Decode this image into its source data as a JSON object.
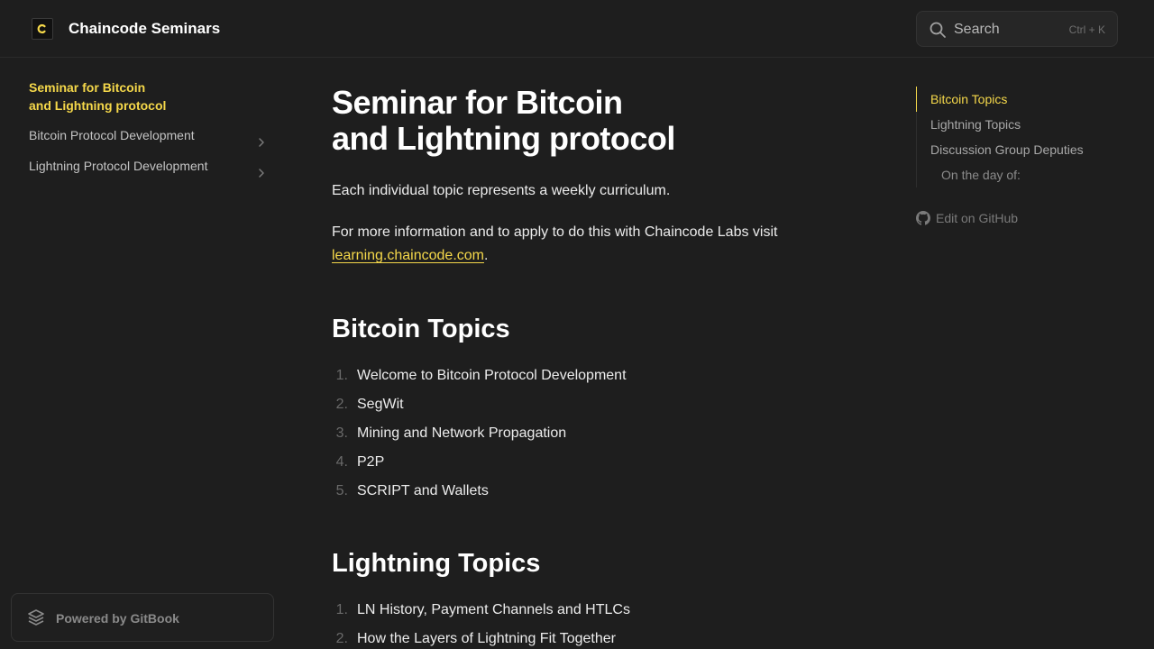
{
  "header": {
    "site_title": "Chaincode Seminars",
    "search": {
      "label": "Search",
      "shortcut": "Ctrl + K"
    }
  },
  "sidebar": {
    "active_page_line1": "Seminar for Bitcoin",
    "active_page_line2": "and Lightning protocol",
    "items": [
      {
        "label": "Bitcoin Protocol Development"
      },
      {
        "label": "Lightning Protocol Development"
      }
    ],
    "powered_by": "Powered by GitBook"
  },
  "main": {
    "title_line1": "Seminar for Bitcoin",
    "title_line2": "and Lightning protocol",
    "intro": "Each individual topic represents a weekly curriculum.",
    "info_prefix": "For more information and to apply to do this with Chaincode Labs visit",
    "info_link": "learning.chaincode.com",
    "info_suffix": ".",
    "bitcoin_heading": "Bitcoin Topics",
    "bitcoin_topics": [
      {
        "num": "1.",
        "text": "Welcome to Bitcoin Protocol Development"
      },
      {
        "num": "2.",
        "text": "SegWit"
      },
      {
        "num": "3.",
        "text": "Mining and Network Propagation"
      },
      {
        "num": "4.",
        "text": "P2P"
      },
      {
        "num": "5.",
        "text": "SCRIPT and Wallets"
      }
    ],
    "lightning_heading": "Lightning Topics",
    "lightning_topics": [
      {
        "num": "1.",
        "text": "LN History, Payment Channels and HTLCs"
      },
      {
        "num": "2.",
        "text": "How the Layers of Lightning Fit Together"
      }
    ]
  },
  "toc": {
    "items": [
      {
        "label": "Bitcoin Topics"
      },
      {
        "label": "Lightning Topics"
      },
      {
        "label": "Discussion Group Deputies"
      },
      {
        "label": "On the day of:"
      }
    ],
    "edit_on_github": "Edit on GitHub"
  },
  "colors": {
    "background": "#1e1e1e",
    "accent": "#f5d84a",
    "text": "#ececec",
    "muted": "#a8a8a8"
  },
  "icons": [
    "chaincode-logo-icon",
    "search-icon",
    "chevron-right-icon",
    "gitbook-icon",
    "github-icon"
  ]
}
